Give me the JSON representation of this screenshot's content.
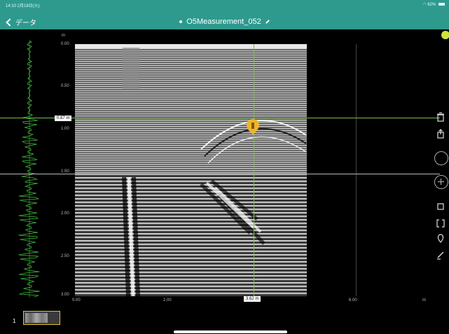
{
  "status_bar": {
    "time": "14:10 2月18日(火)",
    "battery": "62%"
  },
  "header": {
    "back_label": "データ",
    "title": "O5Measurement_052"
  },
  "depth_axis": {
    "unit": "m",
    "labels": [
      "0.00",
      "0.50",
      "1.00",
      "1.50",
      "2.00",
      "2.50",
      "3.00"
    ]
  },
  "distance_axis": {
    "unit": "m",
    "labels": [
      "0.00",
      "2.00",
      "6.00"
    ]
  },
  "cursor": {
    "depth_readout": "0.87 m",
    "distance_readout": "3.62 m"
  },
  "bottom_strip": {
    "page_number": "1"
  },
  "colors": {
    "header_bg": "#2e9a8e",
    "cursor": "#7ac143",
    "marker": "#f0b429",
    "thumb_border": "#e0c12c",
    "sync_dot": "#cfe23a"
  },
  "icons": [
    "trash-icon",
    "share-icon",
    "circle-button",
    "add-icon",
    "crop-icon",
    "bracket-icon",
    "marker-icon",
    "pen-icon"
  ]
}
